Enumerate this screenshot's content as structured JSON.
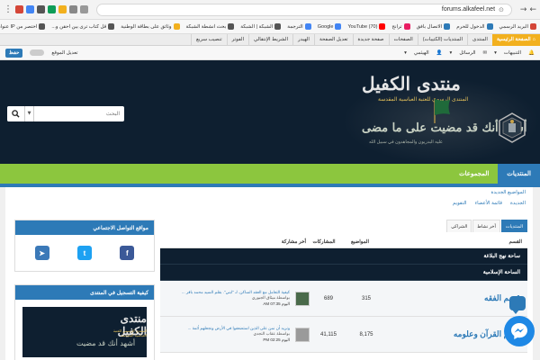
{
  "browser": {
    "url": "forums.alkafeel.net",
    "bookmarks": [
      {
        "label": "البريد الرسمي",
        "color": "#d44638"
      },
      {
        "label": "الدخول للحرم",
        "color": "#2d7ab7"
      },
      {
        "label": "الاتصال بافق",
        "color": "#2d7ab7"
      },
      {
        "label": "ترانج",
        "color": "#e91e63"
      },
      {
        "label": "(70) YouTube",
        "color": "#ff0000"
      },
      {
        "label": "Google",
        "color": "#4285f4"
      },
      {
        "label": "الترجمة",
        "color": "#4285f4"
      },
      {
        "label": "الشبكة | الشبكة",
        "color": "#555"
      },
      {
        "label": "بحث انشطة الشبكة",
        "color": "#555"
      },
      {
        "label": "وثائق على بطاقة الوطنية",
        "color": "#f2b01e"
      },
      {
        "label": "قل كتاب ترى بين احقن و...",
        "color": "#555"
      },
      {
        "label": "اختصر من IP عنوان",
        "color": "#555"
      },
      {
        "label": "الإشارات الأخرى",
        "color": "#f2b01e"
      }
    ]
  },
  "adminbar": {
    "home": "الصفحة الرئيسية",
    "items": [
      "المنتدى",
      "المنتديات (الكتيبات)",
      "الصفحات",
      "صفحة جديدة",
      "تعديل الصفحة",
      "الهيدر",
      "الشريط الإنتقالي",
      "الفوتر",
      "تنصيب سريع"
    ]
  },
  "userbar": {
    "notifications": "التنبيهات",
    "messages": "الرسائل",
    "user": "الهيثمي",
    "edit_site": "تعديل الموقع",
    "save": "حفظ"
  },
  "header": {
    "title": "منتدى الكفيل",
    "subtitle": "المنتدى الرسمي للعتبة العباسية المقدسة",
    "calligraphy": "أشهد أنك قد مضيت على ما مضى",
    "calligraphy_sub": "عليه البدريون والمجاهدون في سبيل الله"
  },
  "search": {
    "placeholder": "البحث"
  },
  "tabs": [
    {
      "label": "المنتديات",
      "active": true
    },
    {
      "label": "المجموعات",
      "active": false
    }
  ],
  "subnav": {
    "row1": [
      "المواضيع الجديدة"
    ],
    "row2": [
      "الجديدة",
      "قائمة الأعضاء",
      "التقويم"
    ]
  },
  "forum_tabs": [
    {
      "label": "المنتديات",
      "active": true
    },
    {
      "label": "أخر نشاط",
      "active": false
    },
    {
      "label": "الشراكي",
      "active": false
    }
  ],
  "forum_table": {
    "headers": {
      "name": "القسم",
      "topics": "المواضيع",
      "posts": "المشاركات",
      "last": "أخر مشاركة"
    },
    "sections": [
      {
        "title": "ساحة نهج البلاغة"
      },
      {
        "title": "الساحة الإسلامية"
      }
    ],
    "rows": [
      {
        "name": "قسم الفقه",
        "topics": "315",
        "posts": "689",
        "last_title": "كيفية التعامل مع العقد الساكن. لـ \"ابني\". بقلم السيد محمد باقر ...",
        "last_by": "بواسطة ميثاق الجبوري",
        "last_date": "اليوم 07:35 AM"
      },
      {
        "name": "قسم القرآن وعلومه",
        "topics": "8,175",
        "posts": "41,115",
        "last_title": "ونريد أن نمن على الذين استضعفوا في الأرض ونجعلهم أئمة ...",
        "last_by": "بواسطة عقاب النجدي",
        "last_date": "اليوم 02:25 PM"
      }
    ]
  },
  "sidebar": {
    "social_title": "مواقع التواصل الاجتماعي",
    "register_title": "كيفية التسجيل في المنتدى",
    "video_title": "منتدى الكفيل",
    "video_sub": "المنتدى الرسمي للعتبة العباسية المقدسة",
    "video_call": "أشهد أنك قد مضيت"
  },
  "colors": {
    "brand_blue": "#2d7ab7",
    "brand_green": "#8cc63e",
    "header_navy": "#0e1f30",
    "admin_orange": "#f2b01e"
  }
}
